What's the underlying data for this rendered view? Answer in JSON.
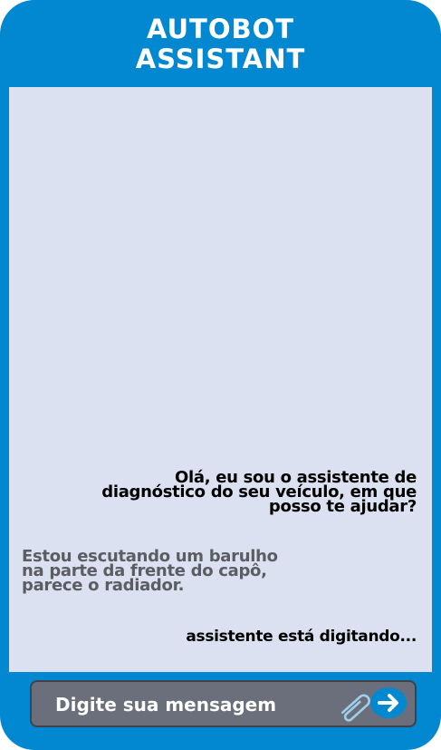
{
  "header": {
    "title_line1": "AUTOBOT",
    "title_line2": "ASSISTANT"
  },
  "messages": {
    "bot": {
      "line1": "Olá, eu sou o assistente de",
      "line2": "diagnóstico do seu veículo, em que",
      "line3": "posso te ajudar?"
    },
    "user": {
      "line1": "Estou escutando um barulho",
      "line2": "na parte da frente do capô,",
      "line3": "parece o radiador."
    },
    "typing": "assistente está digitando..."
  },
  "input": {
    "placeholder": "Digite sua mensagem"
  },
  "icons": {
    "attach": "paperclip-icon",
    "send": "arrow-right-icon"
  },
  "colors": {
    "frame": "#0288d1",
    "chat_background": "#dce1f2",
    "input_background": "#6b6f7b",
    "user_text": "#5b5d63",
    "bot_text": "#000000"
  }
}
